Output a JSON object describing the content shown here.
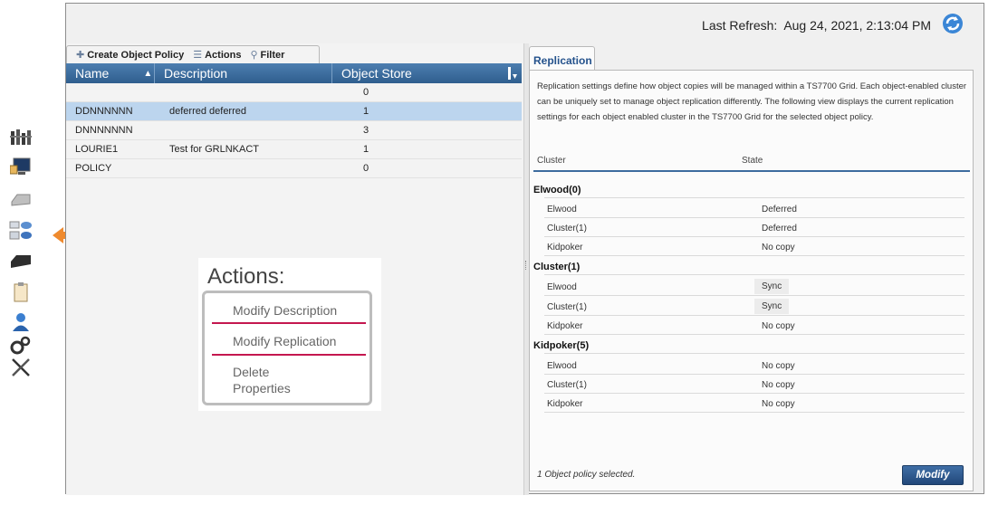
{
  "header": {
    "last_refresh_label": "Last Refresh:",
    "last_refresh_value": "Aug 24, 2021, 2:13:04 PM",
    "refresh_icon": "refresh-icon"
  },
  "sidebar": {
    "icons": [
      "system-health-icon",
      "monitor-icon",
      "virtual-drive-icon",
      "storage-pool-icon",
      "physical-drive-icon",
      "clipboard-icon",
      "user-access-icon",
      "settings-gears-icon",
      "service-tools-icon"
    ],
    "pointer": "arrow-left-icon",
    "pointer_color": "#ef8a2e"
  },
  "toolbar": {
    "create_label": "Create Object Policy",
    "actions_label": "Actions",
    "filter_label": "Filter"
  },
  "grid": {
    "columns": [
      "Name",
      "Description",
      "Object Store"
    ],
    "rows": [
      {
        "name": "",
        "description": "",
        "object_store": "0",
        "selected": false
      },
      {
        "name": "DDNNNNNN",
        "description": "deferred deferred",
        "object_store": "1",
        "selected": true
      },
      {
        "name": "DNNNNNNN",
        "description": "",
        "object_store": "3",
        "selected": false
      },
      {
        "name": "LOURIE1",
        "description": "Test for GRLNKACT",
        "object_store": "1",
        "selected": false
      },
      {
        "name": "POLICY",
        "description": "",
        "object_store": "0",
        "selected": false
      }
    ]
  },
  "actions_callout": {
    "title": "Actions:",
    "items": [
      "Modify Description",
      "Modify Replication",
      "Delete",
      "Properties"
    ]
  },
  "replication": {
    "tab_label": "Replication",
    "description": "Replication settings define how object copies will be managed within a TS7700 Grid. Each object-enabled cluster can be uniquely set to manage object replication differently. The following view displays the current replication settings for each object enabled cluster in the TS7700 Grid for the selected object policy.",
    "col_cluster": "Cluster",
    "col_state": "State",
    "groups": [
      {
        "name": "Elwood(0)",
        "rows": [
          {
            "cluster": "Elwood",
            "state": "Deferred"
          },
          {
            "cluster": "Cluster(1)",
            "state": "Deferred"
          },
          {
            "cluster": "Kidpoker",
            "state": "No copy"
          }
        ]
      },
      {
        "name": "Cluster(1)",
        "rows": [
          {
            "cluster": "Elwood",
            "state": "Sync"
          },
          {
            "cluster": "Cluster(1)",
            "state": "Sync"
          },
          {
            "cluster": "Kidpoker",
            "state": "No copy"
          }
        ]
      },
      {
        "name": "Kidpoker(5)",
        "rows": [
          {
            "cluster": "Elwood",
            "state": "No copy"
          },
          {
            "cluster": "Cluster(1)",
            "state": "No copy"
          },
          {
            "cluster": "Kidpoker",
            "state": "No copy"
          }
        ]
      }
    ],
    "footer": "1 Object policy selected.",
    "modify_label": "Modify"
  }
}
